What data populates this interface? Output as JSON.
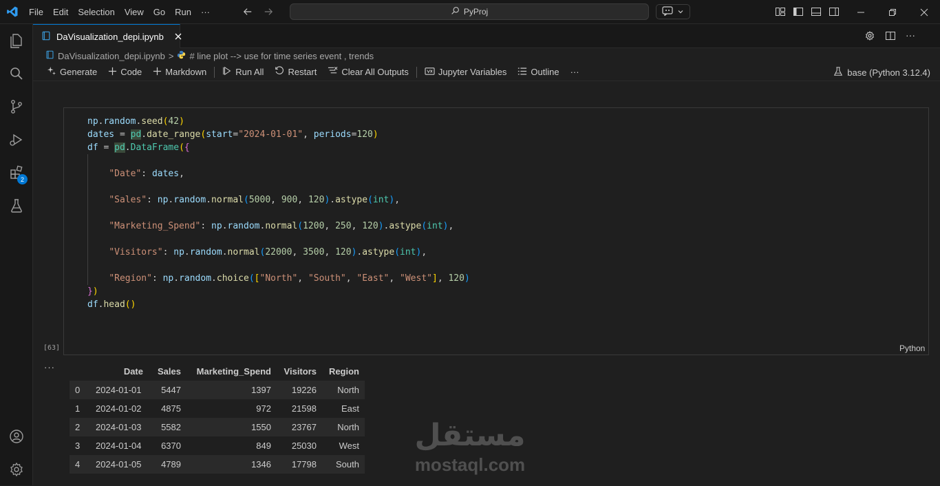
{
  "titlebar": {
    "menu": [
      "File",
      "Edit",
      "Selection",
      "View",
      "Go",
      "Run",
      "···"
    ],
    "search_text": "PyProj"
  },
  "activity_bar": {
    "items": [
      "explorer-icon",
      "search-icon",
      "source-control-icon",
      "run-debug-icon",
      "extensions-icon",
      "testing-icon"
    ],
    "extensions_badge": "2",
    "bottom_items": [
      "accounts-icon",
      "manage-gear-icon"
    ]
  },
  "editor": {
    "tab_title": "DaVisualization_depi.ipynb",
    "breadcrumb": {
      "file": "DaVisualization_depi.ipynb",
      "separator": ">",
      "cell": "# line plot --> use for time series event , trends"
    }
  },
  "toolbar": {
    "generate": "Generate",
    "code": "Code",
    "markdown": "Markdown",
    "run_all": "Run All",
    "restart": "Restart",
    "clear_outputs": "Clear All Outputs",
    "jupyter_variables": "Jupyter Variables",
    "outline": "Outline",
    "more": "···",
    "kernel": "base (Python 3.12.4)"
  },
  "cell": {
    "execution_count": "[63]",
    "language": "Python",
    "code_lines": [
      "np.random.seed(42)",
      "dates = pd.date_range(start=\"2024-01-01\", periods=120)",
      "df = pd.DataFrame({",
      "",
      "    \"Date\": dates,",
      "",
      "    \"Sales\": np.random.normal(5000, 900, 120).astype(int),",
      "",
      "    \"Marketing_Spend\": np.random.normal(1200, 250, 120).astype(int),",
      "",
      "    \"Visitors\": np.random.normal(22000, 3500, 120).astype(int),",
      "",
      "    \"Region\": np.random.choice([\"North\", \"South\", \"East\", \"West\"], 120)",
      "})",
      "df.head()"
    ]
  },
  "output": {
    "dots": "···",
    "table": {
      "columns": [
        "",
        "Date",
        "Sales",
        "Marketing_Spend",
        "Visitors",
        "Region"
      ],
      "rows": [
        [
          "0",
          "2024-01-01",
          "5447",
          "1397",
          "19226",
          "North"
        ],
        [
          "1",
          "2024-01-02",
          "4875",
          "972",
          "21598",
          "East"
        ],
        [
          "2",
          "2024-01-03",
          "5582",
          "1550",
          "23767",
          "North"
        ],
        [
          "3",
          "2024-01-04",
          "6370",
          "849",
          "25030",
          "West"
        ],
        [
          "4",
          "2024-01-05",
          "4789",
          "1346",
          "17798",
          "South"
        ]
      ]
    }
  },
  "watermark": {
    "arabic": "مستقل",
    "latin": "mostaql.com"
  }
}
